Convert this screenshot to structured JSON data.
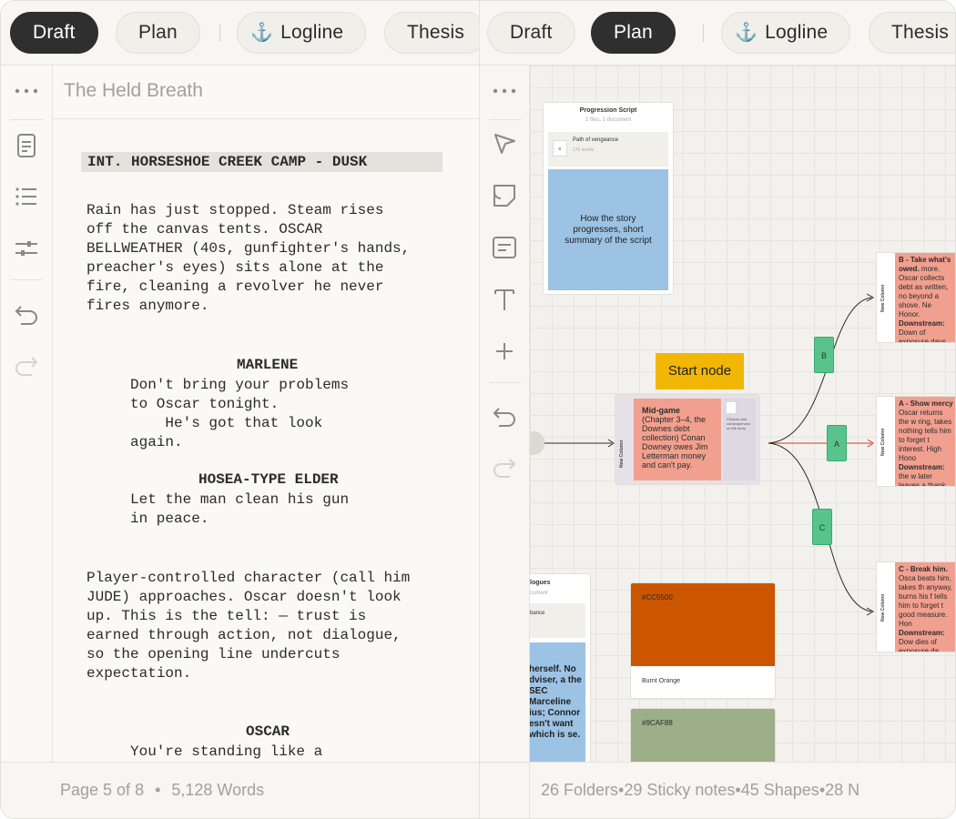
{
  "left_pane": {
    "tabs": [
      "Draft",
      "Plan",
      "Logline",
      "Thesis"
    ],
    "active_tab": "Draft",
    "doc_title": "The Held Breath",
    "script": {
      "slugline": "INT. HORSESHOE CREEK CAMP - DUSK",
      "action1": "Rain has just stopped. Steam rises\noff the canvas tents. OSCAR\nBELLWEATHER (40s, gunfighter's hands,\npreacher's eyes) sits alone at the\nfire, cleaning a revolver he never\nfires anymore.",
      "char1": "MARLENE",
      "dialogue1": "Don't bring your problems\nto Oscar tonight.\n    He's got that look\nagain.",
      "char2": "HOSEA-TYPE ELDER",
      "dialogue2": "Let the man clean his gun\nin peace.",
      "action2": "Player-controlled character (call him\nJUDE) approaches. Oscar doesn't look\nup. This is the tell: — trust is\nearned through action, not dialogue,\nso the opening line undercuts\nexpectation.",
      "char3": "OSCAR",
      "dialogue3": "You're standing like a"
    },
    "status": {
      "page": "Page 5 of 8",
      "words": "5,128 Words"
    }
  },
  "right_pane": {
    "tabs": [
      "Draft",
      "Plan",
      "Logline",
      "Thesis"
    ],
    "active_tab": "Plan",
    "board": {
      "progression": {
        "title": "Progression Script",
        "subtitle": "2 files, 1 document",
        "item_title": "Path of vengeance",
        "item_sub": "176 words",
        "sticky": "How the story progresses, short summary of the script"
      },
      "start_node": "Start node",
      "center_card": {
        "side": "New Column",
        "title": "Mid-game",
        "text": "(Chapter 3–4, the Downes debt collection) Conan Downey owes Jim Letterman money and can't pay.",
        "aside": "Choices and consequences on the story"
      },
      "branches": [
        "B",
        "A",
        "C"
      ],
      "outcome_b": {
        "side": "New Column",
        "heading": "B - Take what's owed.",
        "text": "more. Oscar collects debt as written, no beyond a shove. Ne Honor.",
        "downstream_label": "Downstream:",
        "downstream": "Down of exposure days la widow curses Oscar in a graveside scene the epilogue."
      },
      "outcome_a": {
        "side": "New Column",
        "heading": "A - Show mercy",
        "text": "Oscar returns the w ring, takes nothing tells him to forget t interest. High Hono",
        "downstream_label": "Downstream:",
        "downstream": "the w later leaves a thank note at camp; a mission unlocks wh asks for help findin"
      },
      "outcome_c": {
        "side": "New Column",
        "heading": "C - Break him.",
        "text": "Osca beats him, takes th anyway, burns his f tells him to forget t good measure. Hon",
        "downstream_label": "Downstream:",
        "downstream": "Dow dies of exposure da later; his widow curse Oscar's name in a graveside scene ne epilogue."
      },
      "dialogues_card": {
        "title": "logues",
        "subtitle": "cument",
        "item": "bance",
        "sticky": "herself. No dviser, a the SEC Marceline ius; Connor esn't want which is se."
      },
      "swatch1": {
        "hex": "#CC5500",
        "name": "Burnt Orange",
        "color": "#CC5500"
      },
      "swatch2": {
        "hex": "#9CAF88",
        "color": "#9CAF88"
      }
    },
    "status": {
      "folders": "26 Folders",
      "sticky": "29 Sticky notes",
      "shapes": "45 Shapes",
      "more": "28 N"
    }
  },
  "colors": {
    "active_tab": "#2f2f2f",
    "anchor": "#c0392b",
    "start_node": "#f2b705",
    "branch": "#58c48c",
    "scene_card": "#f1a08f",
    "sticky_blue": "#9cc3e4"
  }
}
